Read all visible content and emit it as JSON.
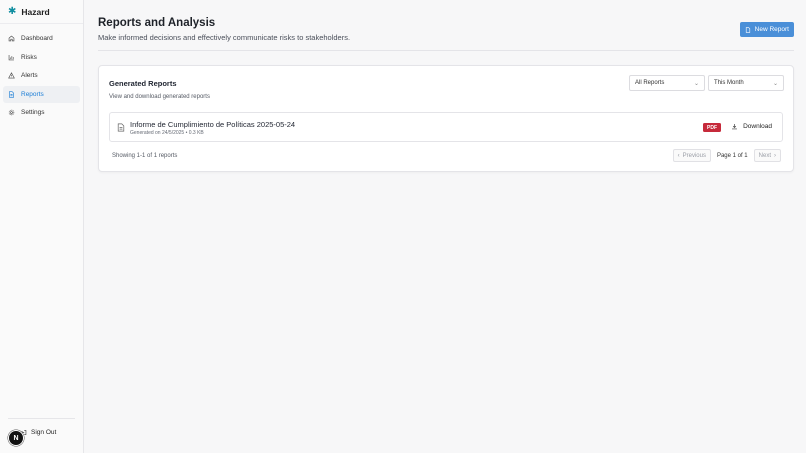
{
  "brand": {
    "name": "Hazard",
    "logo_icon": "asterisk-icon",
    "accent": "#0f8ea0"
  },
  "sidebar": {
    "items": [
      {
        "label": "Dashboard",
        "icon": "home-icon",
        "active": false
      },
      {
        "label": "Risks",
        "icon": "bar-chart-icon",
        "active": false
      },
      {
        "label": "Alerts",
        "icon": "warning-icon",
        "active": false
      },
      {
        "label": "Reports",
        "icon": "document-icon",
        "active": true
      },
      {
        "label": "Settings",
        "icon": "gear-icon",
        "active": false
      }
    ],
    "sign_out": "Sign Out",
    "avatar_letter": "N"
  },
  "header": {
    "title": "Reports and Analysis",
    "subtitle": "Make informed decisions and effectively communicate risks to stakeholders.",
    "new_report_label": "New Report",
    "primary_color": "#4a8fd8"
  },
  "card": {
    "title": "Generated Reports",
    "description": "View and download generated reports",
    "filter_type": {
      "selected": "All Reports"
    },
    "filter_period": {
      "selected": "This Month"
    }
  },
  "reports": [
    {
      "name": "Informe de Cumplimiento de Políticas 2025-05-24",
      "meta": "Generated on 24/5/2025 • 0.3 KB",
      "format": "PDF",
      "badge_color": "#c62a3b",
      "download_label": "Download"
    }
  ],
  "pagination": {
    "showing": "Showing 1-1 of 1 reports",
    "previous": "Previous",
    "page_text": "Page 1 of 1",
    "next": "Next"
  }
}
